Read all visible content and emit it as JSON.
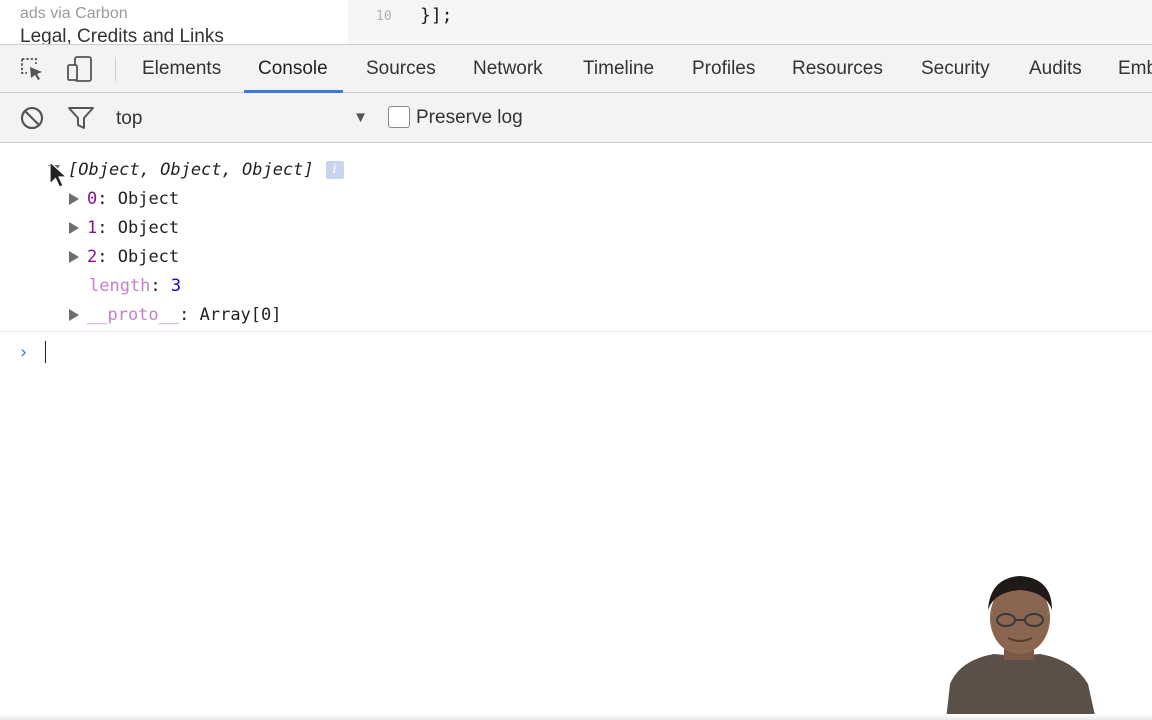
{
  "page_behind": {
    "ads_text": "ads via Carbon",
    "legal_text": "Legal, Credits and Links",
    "code_line_number": "10",
    "code_line_text": "}];"
  },
  "devtools": {
    "tabs": [
      {
        "label": "Elements"
      },
      {
        "label": "Console",
        "active": true
      },
      {
        "label": "Sources"
      },
      {
        "label": "Network"
      },
      {
        "label": "Timeline"
      },
      {
        "label": "Profiles"
      },
      {
        "label": "Resources"
      },
      {
        "label": "Security"
      },
      {
        "label": "Audits"
      },
      {
        "label": "Emb"
      }
    ],
    "icons": {
      "inspect": "inspect-element-icon",
      "device": "device-mode-icon",
      "clear": "clear-console-icon",
      "filter": "filter-icon"
    },
    "accent_color": "#3879d9"
  },
  "toolbar": {
    "context_value": "top",
    "preserve_log_label": "Preserve log",
    "preserve_log_checked": false
  },
  "console": {
    "array_summary": "[Object, Object, Object]",
    "info_badge": "i",
    "items": [
      {
        "key": "0",
        "sep": ": ",
        "value": "Object"
      },
      {
        "key": "1",
        "sep": ": ",
        "value": "Object"
      },
      {
        "key": "2",
        "sep": ": ",
        "value": "Object"
      }
    ],
    "length_key": "length",
    "length_sep": ": ",
    "length_value": "3",
    "proto_key": "__proto__",
    "proto_sep": ": ",
    "proto_value": "Array[0]",
    "prompt_symbol": "›"
  }
}
